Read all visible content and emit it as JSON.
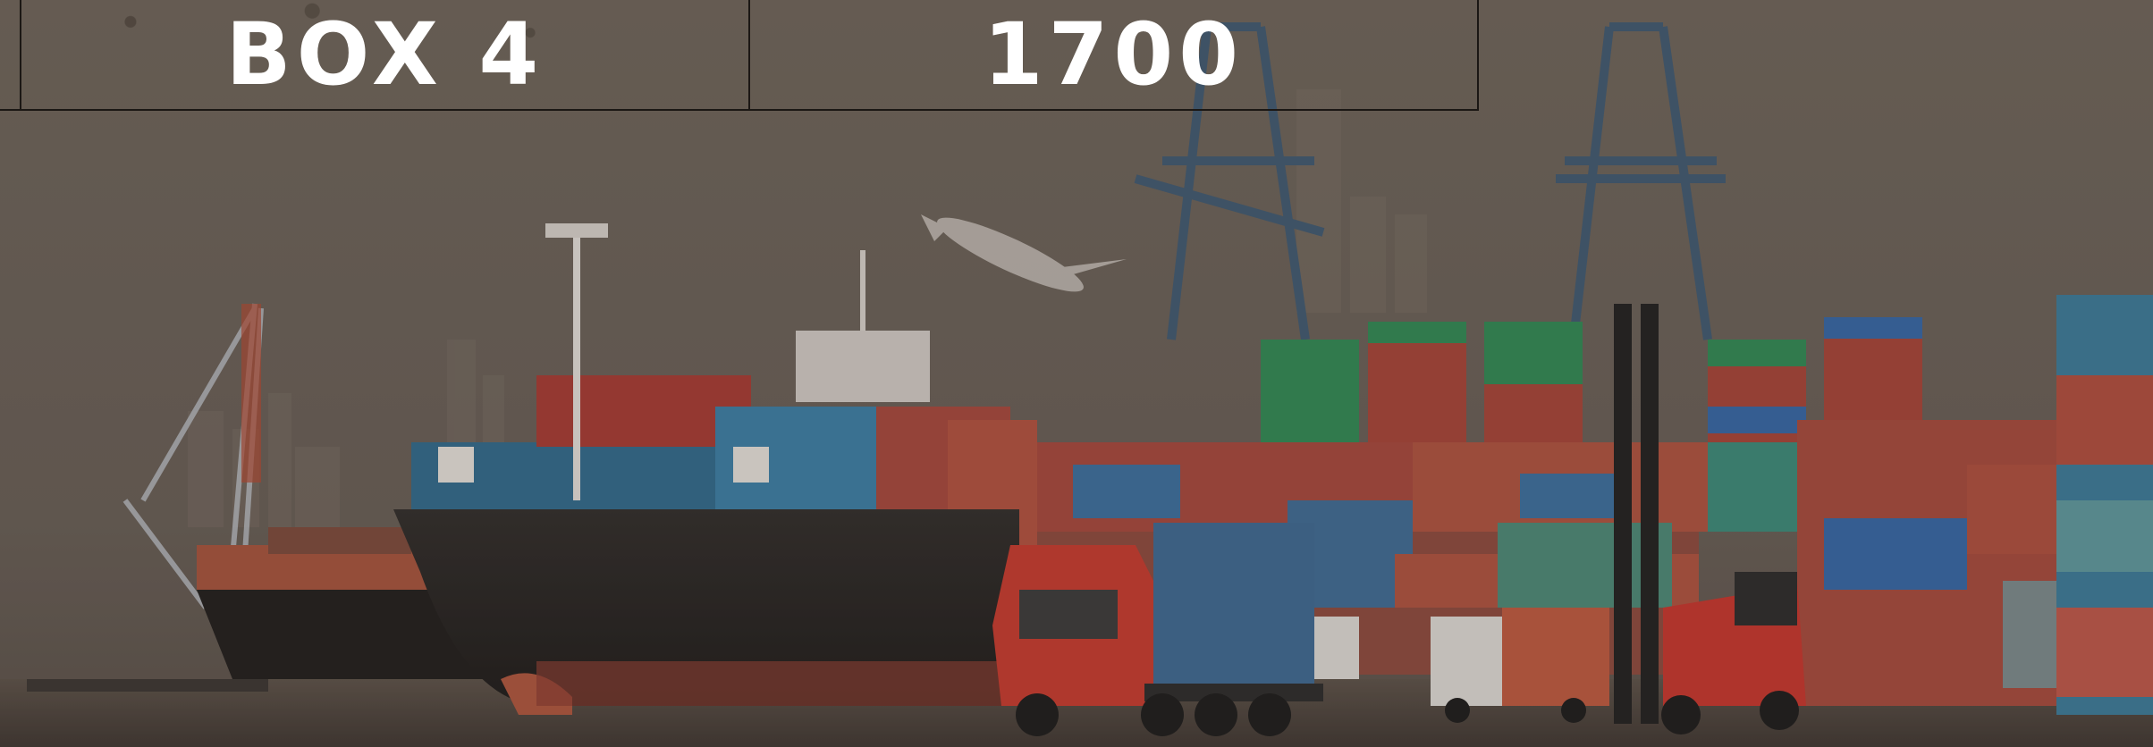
{
  "table": {
    "label": "BOX 4",
    "value": "1700"
  },
  "colors": {
    "text": "#ffffff",
    "border": "#1b1714",
    "background": "#6b6258"
  }
}
